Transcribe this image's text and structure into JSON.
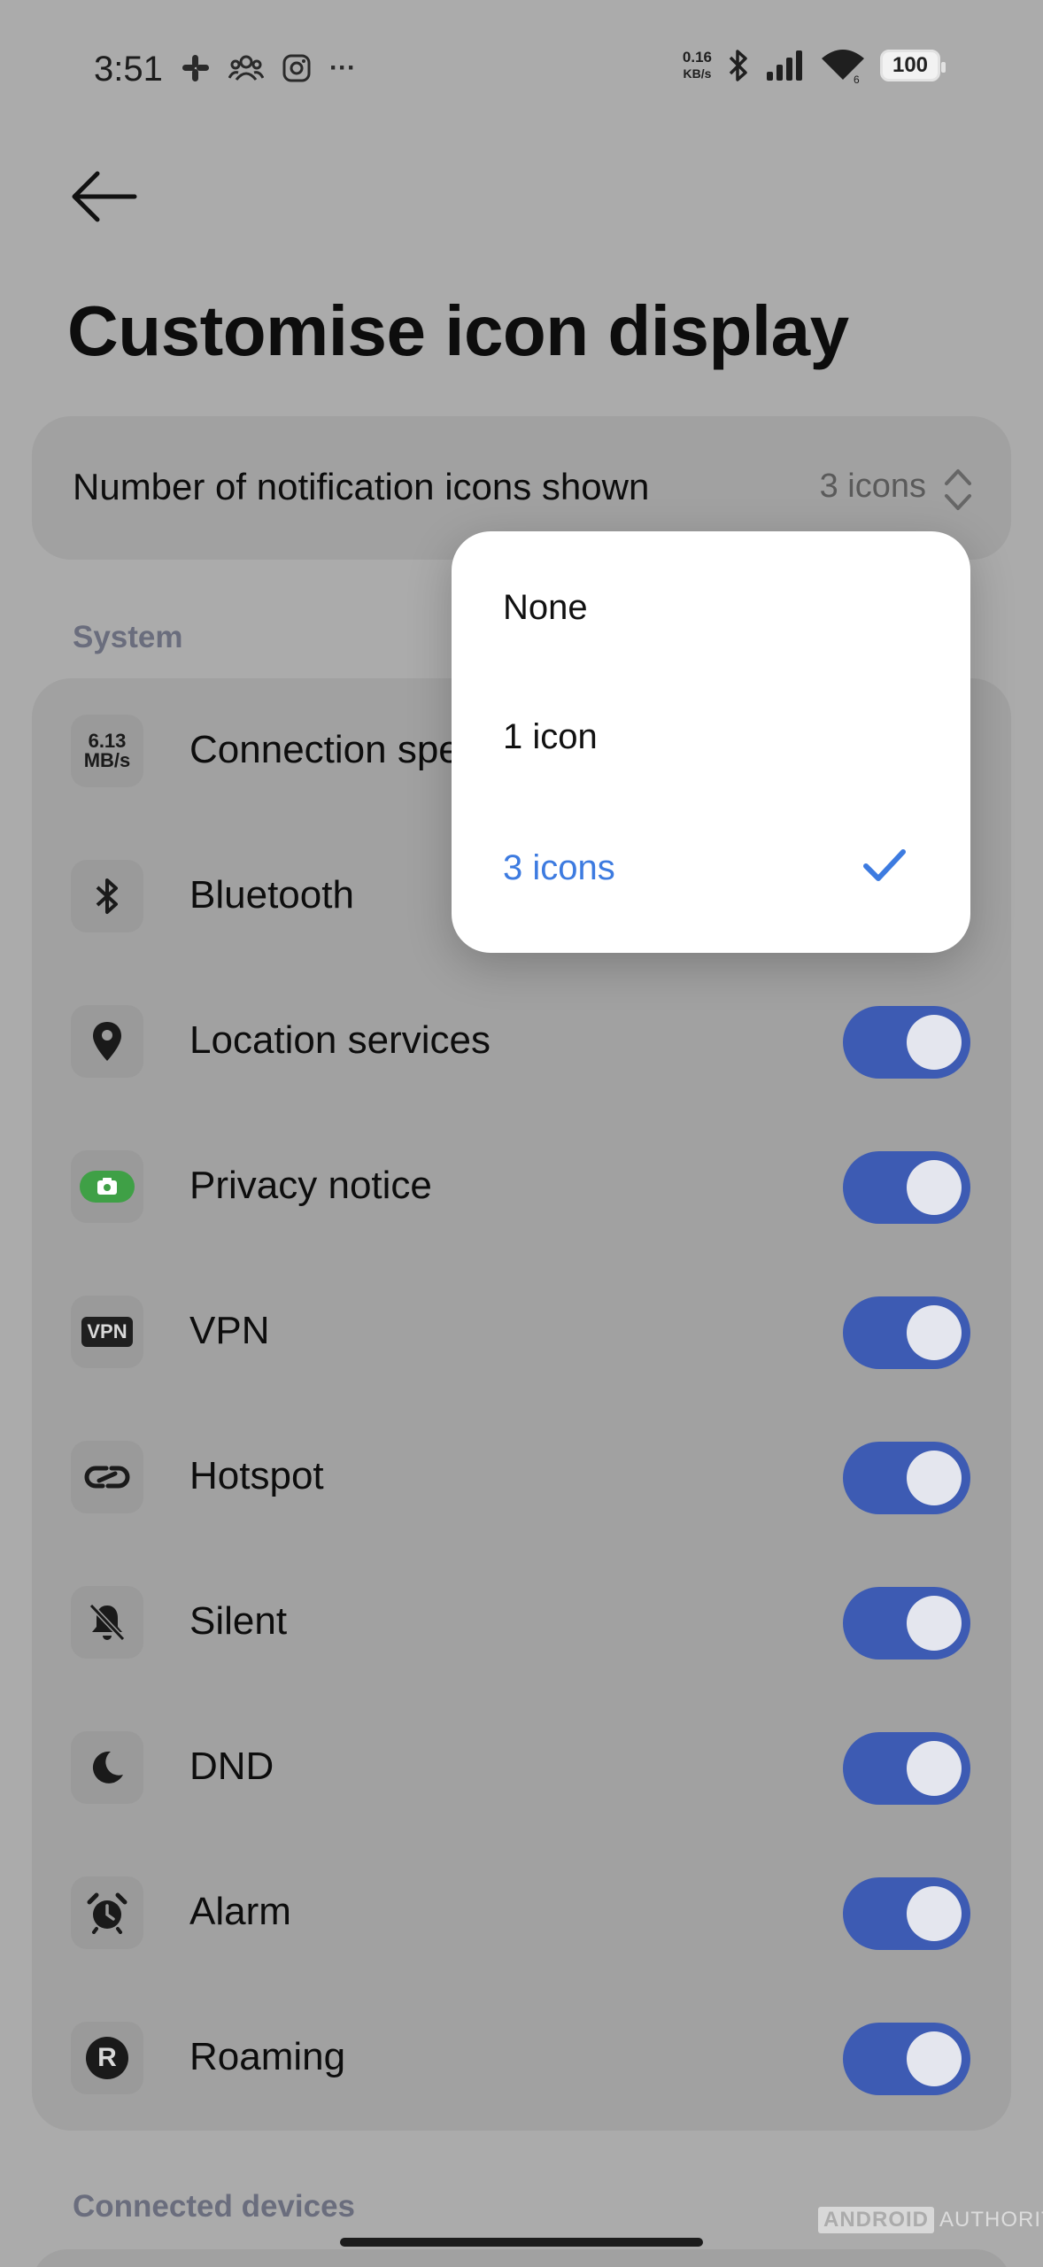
{
  "status_bar": {
    "time": "3:51",
    "net_speed_value": "0.16",
    "net_speed_unit": "KB/s",
    "battery": "100",
    "more_indicator": "···"
  },
  "page": {
    "title": "Customise icon display"
  },
  "notification_setting": {
    "label": "Number of notification icons shown",
    "value": "3 icons"
  },
  "dropdown": {
    "options": [
      "None",
      "1 icon",
      "3 icons"
    ],
    "selected": "3 icons"
  },
  "system_section": {
    "label": "System",
    "items": [
      {
        "label": "Connection speed",
        "icon": "connection-speed-icon",
        "icon_text_top": "6.13",
        "icon_text_bottom": "MB/s",
        "toggle": null
      },
      {
        "label": "Bluetooth",
        "icon": "bluetooth-icon",
        "toggle": null
      },
      {
        "label": "Location services",
        "icon": "location-pin-icon",
        "toggle": true
      },
      {
        "label": "Privacy notice",
        "icon": "camera-icon",
        "toggle": true
      },
      {
        "label": "VPN",
        "icon": "vpn-icon",
        "icon_text": "VPN",
        "toggle": true
      },
      {
        "label": "Hotspot",
        "icon": "hotspot-link-icon",
        "toggle": true
      },
      {
        "label": "Silent",
        "icon": "bell-off-icon",
        "toggle": true
      },
      {
        "label": "DND",
        "icon": "moon-icon",
        "toggle": true
      },
      {
        "label": "Alarm",
        "icon": "alarm-clock-icon",
        "toggle": true
      },
      {
        "label": "Roaming",
        "icon": "roaming-r-icon",
        "icon_text": "R",
        "toggle": true
      }
    ]
  },
  "connected_devices_section": {
    "label": "Connected devices"
  },
  "watermark": {
    "brand": "ANDROID",
    "suffix": "AUTHORITY"
  },
  "colors": {
    "toggle_on": "#3d5bb3",
    "selected_option": "#3d7be0",
    "privacy_icon_green": "#3fa046"
  }
}
